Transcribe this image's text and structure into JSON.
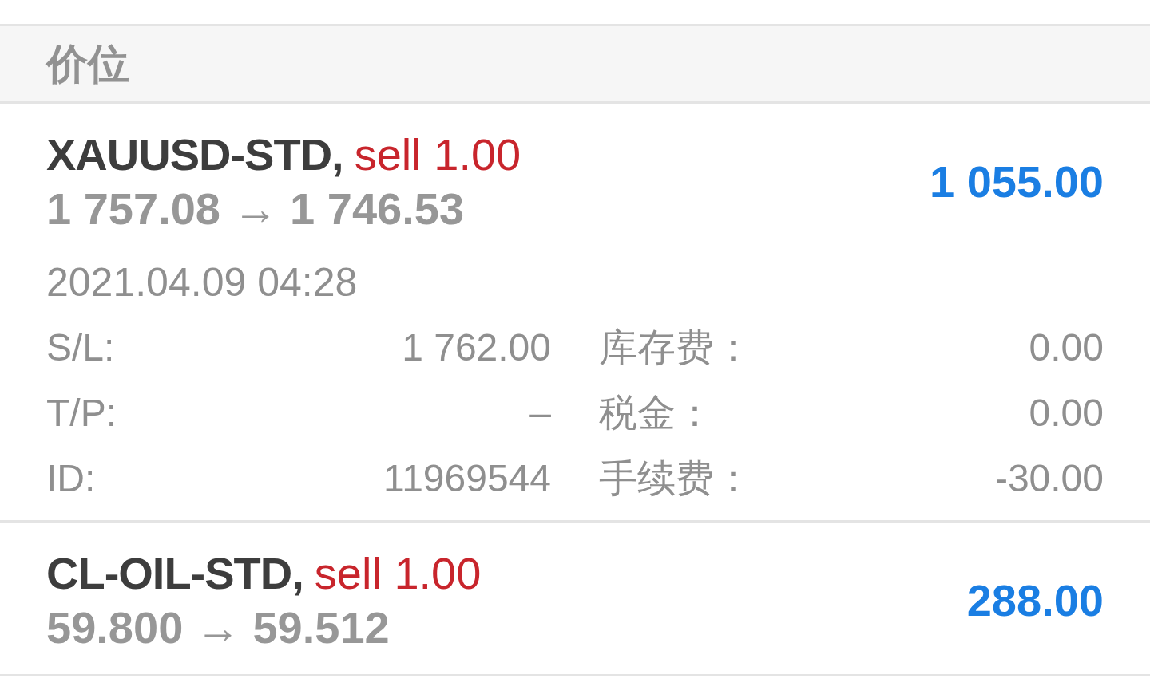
{
  "header": {
    "title": "价位"
  },
  "trades": [
    {
      "symbol": "XAUUSD-STD,",
      "side": "sell 1.00",
      "prices": "1 757.08 → 1 746.53",
      "profit": "1 055.00",
      "time": "2021.04.09 04:28",
      "details": [
        {
          "label": "S/L:",
          "value": "1 762.00"
        },
        {
          "label": "库存费：",
          "value": "0.00"
        },
        {
          "label": "T/P:",
          "value": "–"
        },
        {
          "label": "税金：",
          "value": "0.00"
        },
        {
          "label": "ID:",
          "value": "11969544"
        },
        {
          "label": "手续费：",
          "value": "-30.00"
        }
      ]
    },
    {
      "symbol": "CL-OIL-STD,",
      "side": "sell 1.00",
      "prices": "59.800 → 59.512",
      "profit": "288.00"
    }
  ]
}
